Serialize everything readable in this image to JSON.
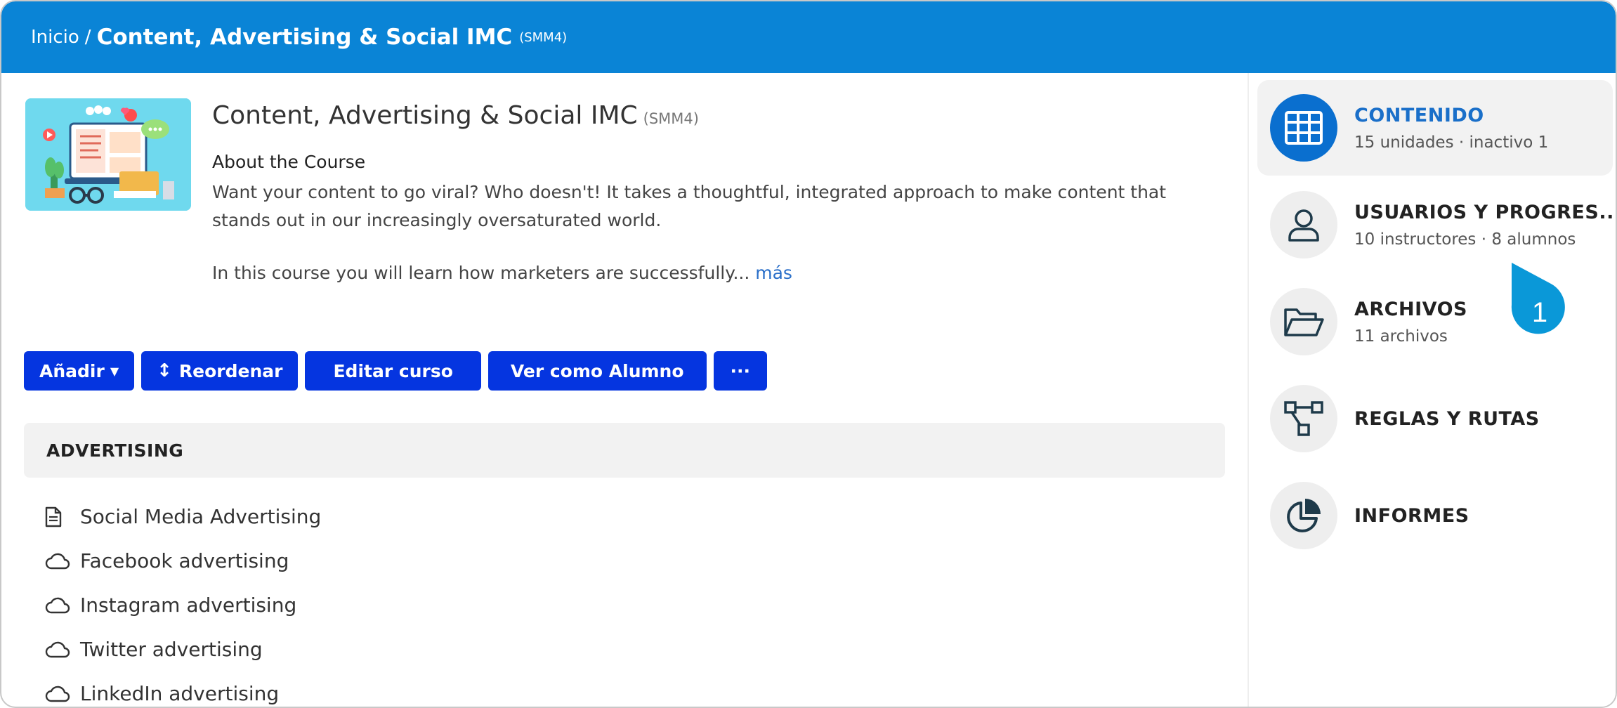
{
  "header": {
    "home": "Inicio",
    "separator": "/",
    "title": "Content, Advertising & Social IMC",
    "code": "(SMM4)"
  },
  "course": {
    "title": "Content, Advertising & Social IMC",
    "code": "(SMM4)",
    "about_heading": "About the Course",
    "about_text": "Want your content to go viral? Who doesn't! It takes a thoughtful, integrated approach to make content that stands out in our increasingly oversaturated world.",
    "about_more_text": "In this course you will learn how marketers are successfully...",
    "more_link": "más"
  },
  "toolbar": {
    "add_label": "Añadir",
    "reorder_label": "Reordenar",
    "edit_label": "Editar curso",
    "view_as_student_label": "Ver como Alumno",
    "more_label": "···"
  },
  "section": {
    "title": "ADVERTISING"
  },
  "units": [
    {
      "label": "Social Media Advertising",
      "icon": "document-icon"
    },
    {
      "label": "Facebook advertising",
      "icon": "cloud-icon"
    },
    {
      "label": "Instagram advertising",
      "icon": "cloud-icon"
    },
    {
      "label": "Twitter advertising",
      "icon": "cloud-icon"
    },
    {
      "label": "LinkedIn advertising",
      "icon": "cloud-icon"
    }
  ],
  "sidebar": {
    "items": [
      {
        "title": "CONTENIDO",
        "subtitle": "15 unidades · inactivo 1",
        "icon": "grid-icon",
        "active": true
      },
      {
        "title": "USUARIOS Y PROGRES...",
        "subtitle": "10 instructores · 8 alumnos",
        "icon": "user-icon"
      },
      {
        "title": "ARCHIVOS",
        "subtitle": "11 archivos",
        "icon": "folder-open-icon"
      },
      {
        "title": "REGLAS Y RUTAS",
        "subtitle": "",
        "icon": "flow-icon"
      },
      {
        "title": "INFORMES",
        "subtitle": "",
        "icon": "pie-chart-icon"
      }
    ]
  },
  "badge": {
    "label": "1"
  },
  "colors": {
    "header_bg": "#0a84d6",
    "button_bg": "#0535e0",
    "link": "#2a6fc9",
    "active_icon_bg": "#0a6fcf",
    "badge_bg": "#0a98d8"
  }
}
